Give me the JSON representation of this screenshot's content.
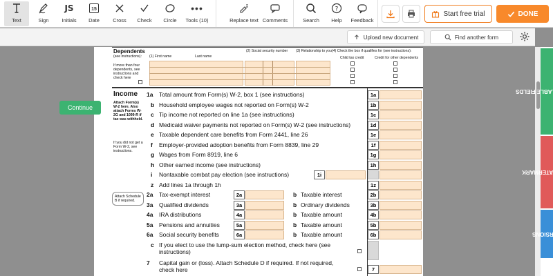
{
  "toolbar": {
    "tools": [
      {
        "id": "text",
        "label": "Text",
        "icon": "text-cursor-icon"
      },
      {
        "id": "sign",
        "label": "Sign",
        "icon": "pen-sign-icon"
      },
      {
        "id": "initials",
        "label": "Initials",
        "icon": "initials-icon",
        "glyph": "JS"
      },
      {
        "id": "date",
        "label": "Date",
        "icon": "calendar-icon",
        "glyph": "15"
      },
      {
        "id": "cross",
        "label": "Cross",
        "icon": "cross-icon"
      },
      {
        "id": "check",
        "label": "Check",
        "icon": "check-icon"
      },
      {
        "id": "circle",
        "label": "Circle",
        "icon": "circle-icon"
      },
      {
        "id": "tools",
        "label": "Tools (10)",
        "icon": "more-dots-icon"
      },
      {
        "id": "replace_text",
        "label": "Replace text",
        "icon": "replace-text-icon"
      },
      {
        "id": "comments",
        "label": "Comments",
        "icon": "comment-icon"
      },
      {
        "id": "search",
        "label": "Search",
        "icon": "search-icon"
      },
      {
        "id": "help",
        "label": "Help",
        "icon": "help-icon"
      },
      {
        "id": "feedback",
        "label": "Feedback",
        "icon": "feedback-icon"
      }
    ],
    "trial_label": "Start free trial",
    "done_label": "DONE",
    "accent": "#f8892b"
  },
  "subbar": {
    "upload_label": "Upload new document",
    "find_label": "Find another form"
  },
  "continue_label": "Continue",
  "form": {
    "dependents": {
      "title": "Dependents",
      "see": "(see instructions):",
      "col1": "(1) First name",
      "col1b": "Last name",
      "col2": "(2) Social security number",
      "col3": "(3) Relationship to you",
      "col4": "(4) Check the box if qualifies for (see instructions):",
      "col4a": "Child tax credit",
      "col4b": "Credit for other dependents",
      "note": "If more than four dependents, see instructions and check here"
    },
    "income_title": "Income",
    "attach_w2": "Attach Form(s) W-2 here. Also attach Forms W-2G and 1099-R if tax was withheld.",
    "no_w2": "If you did not get a Form W-2, see instructions.",
    "attach_b": "Attach Schedule B if required.",
    "lines": [
      {
        "num": "1a",
        "box": "1a",
        "text": "Total amount from Form(s) W-2, box 1 (see instructions)"
      },
      {
        "num": "b",
        "box": "1b",
        "text": "Household employee wages not reported on Form(s) W-2"
      },
      {
        "num": "c",
        "box": "1c",
        "text": "Tip income not reported on line 1a (see instructions)"
      },
      {
        "num": "d",
        "box": "1d",
        "text": "Medicaid waiver payments not reported on Form(s) W-2 (see instructions)"
      },
      {
        "num": "e",
        "box": "1e",
        "text": "Taxable dependent care benefits from Form 2441, line 26"
      },
      {
        "num": "f",
        "box": "1f",
        "text": "Employer-provided adoption benefits from Form 8839, line 29"
      },
      {
        "num": "g",
        "box": "1g",
        "text": "Wages from Form 8919, line 6"
      },
      {
        "num": "h",
        "box": "1h",
        "text": "Other earned income (see instructions)"
      },
      {
        "num": "i",
        "box": "1i",
        "text": "Nontaxable combat pay election (see instructions)"
      },
      {
        "num": "z",
        "box": "1z",
        "text": "Add lines 1a through 1h"
      }
    ],
    "pairs": [
      {
        "num": "2a",
        "left": "Tax-exempt interest",
        "lbox": "2a",
        "rnum": "b",
        "right": "Taxable interest",
        "rbox": "2b"
      },
      {
        "num": "3a",
        "left": "Qualified dividends",
        "lbox": "3a",
        "rnum": "b",
        "right": "Ordinary dividends",
        "rbox": "3b"
      },
      {
        "num": "4a",
        "left": "IRA distributions",
        "lbox": "4a",
        "rnum": "b",
        "right": "Taxable amount",
        "rbox": "4b"
      },
      {
        "num": "5a",
        "left": "Pensions and annuities",
        "lbox": "5a",
        "rnum": "b",
        "right": "Taxable amount",
        "rbox": "5b"
      },
      {
        "num": "6a",
        "left": "Social security benefits",
        "lbox": "6a",
        "rnum": "b",
        "right": "Taxable amount",
        "rbox": "6b"
      }
    ],
    "line6c_num": "c",
    "line6c": "If you elect to use the lump-sum election method, check here (see",
    "line6c_2": "instructions)",
    "line7_num": "7",
    "line7": "Capital gain or (loss). Attach Schedule D if required. If not required,",
    "line7_2": "check here",
    "line7_box": "7"
  },
  "side_tabs": [
    {
      "label": "EDIT FILLABLE FIELDS",
      "color": "#3cb371",
      "icon": "edit-fields-icon"
    },
    {
      "label": "ADD WATERMARK",
      "color": "#e05a5a",
      "icon": "watermark-icon"
    },
    {
      "label": "VERSIONS",
      "color": "#3a8fd8",
      "icon": "clock-icon"
    }
  ]
}
